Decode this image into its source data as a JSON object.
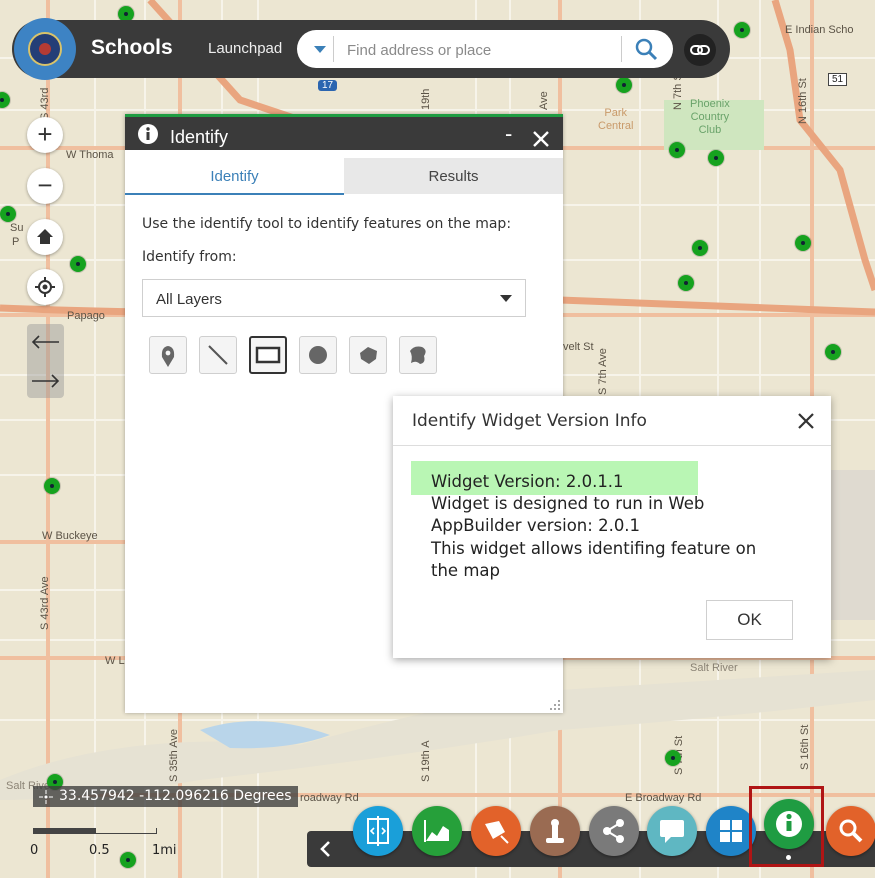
{
  "app": {
    "title": "Schools",
    "launchpad_label": "Launchpad",
    "search_placeholder": "Find address or place",
    "icons": {
      "logo": "city-seal-logo",
      "search_caret": "caret-down-icon",
      "search": "search-icon",
      "share_link": "link-icon"
    }
  },
  "map_labels": {
    "e_indian_school": "E Indian Scho",
    "w_thomas": "W Thoma",
    "papago": "Papago",
    "sun": "Su",
    "p": "P",
    "velt_st": "velt St",
    "w_buckeye": "W Buckeye",
    "wl": "W L",
    "s_43rd_ave_top": "S 43rd",
    "s_43rd_ave": "S 43rd Ave",
    "n_19th": "19th",
    "n_16th_st": "N 16th St",
    "n_7th_st": "N 7th St",
    "s_7th_ave": "S 7th Ave",
    "s_35th_ave": "S 35th Ave",
    "s_19th": "S 19th A",
    "s_7th_st": "S 7th St",
    "s_16th_st": "S 16th St",
    "ave": "Ave",
    "park_central": "Park\nCentral",
    "phoenix_country_club": "Phoenix\nCountry\nClub",
    "salt_river_right": "Salt River",
    "salt_river_left": "Salt River",
    "e_broadway_rd": "E Broadway Rd",
    "broadway_rd": "roadway Rd",
    "hwy_17": "17",
    "hwy_51": "51"
  },
  "nav": {
    "zoom_in": "+",
    "zoom_out": "−",
    "icons": [
      "plus-icon",
      "minus-icon",
      "home-icon",
      "locate-icon",
      "arrow-left-icon",
      "arrow-right-icon"
    ]
  },
  "identify_panel": {
    "title": "Identify",
    "tabs": [
      {
        "label": "Identify",
        "active": true
      },
      {
        "label": "Results",
        "active": false
      }
    ],
    "instruction": "Use the identify tool to identify features on the map:",
    "identify_from_label": "Identify from:",
    "layer_select_value": "All Layers",
    "tools": [
      "point-tool-icon",
      "line-tool-icon",
      "extent-tool-icon",
      "circle-tool-icon",
      "polygon-tool-icon",
      "freehand-polygon-tool-icon"
    ],
    "selected_tool": "extent-tool-icon",
    "minimize": "-",
    "icons": {
      "title": "info-icon",
      "minimize": "minimize-icon",
      "close": "close-icon",
      "resize": "resize-grip-icon"
    }
  },
  "version_dialog": {
    "title": "Identify Widget Version Info",
    "lines": [
      "Widget Version: 2.0.1.1",
      "Widget is designed to run in Web",
      "AppBuilder version: 2.0.1",
      "This widget allows identifing feature on",
      "the map"
    ],
    "ok_label": "OK",
    "highlight_color": "#b9f6b4",
    "icons": {
      "close": "close-icon"
    }
  },
  "coordinates": {
    "text": "33.457942 -112.096216 Degrees",
    "icon": "crosshair-icon"
  },
  "scale": {
    "labels": [
      "0",
      "0.5",
      "1mi"
    ]
  },
  "taskbar": {
    "widgets": [
      {
        "icon": "swipe-icon",
        "color": "#1a9fd9"
      },
      {
        "icon": "chart-icon",
        "color": "#26a03a"
      },
      {
        "icon": "draw-icon",
        "color": "#e2622a"
      },
      {
        "icon": "print-icon",
        "color": "#9a6b52"
      },
      {
        "icon": "share-icon",
        "color": "#7a7a7a"
      },
      {
        "icon": "chat-icon",
        "color": "#5fb7c2"
      },
      {
        "icon": "widget-grid-icon",
        "color": "#1f84c8"
      },
      {
        "icon": "info-icon",
        "color": "#1f9c42",
        "active": true
      },
      {
        "icon": "search-icon",
        "color": "#e2622a"
      }
    ],
    "icons": {
      "previous": "chevron-left-icon"
    },
    "highlight_box_color": "#b01515"
  },
  "colors": {
    "header_bg": "#3a3a3a",
    "accent_green": "#1f9c42",
    "tab_active_blue": "#3b80b8"
  }
}
